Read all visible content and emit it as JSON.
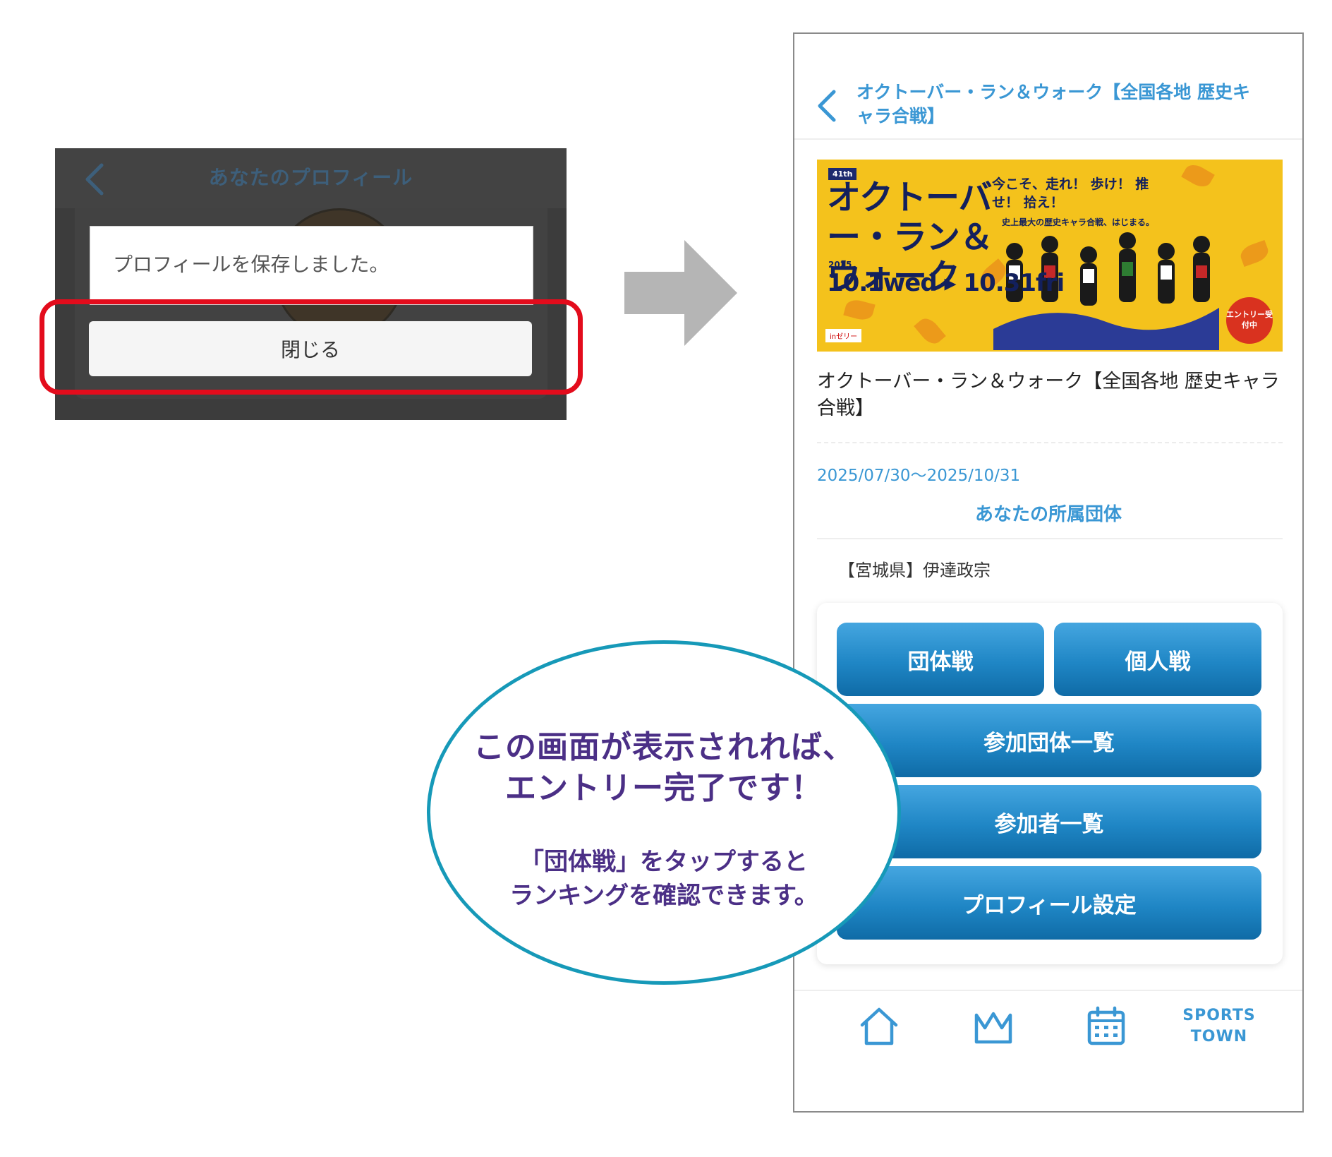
{
  "dialog_screen": {
    "title": "あなたのプロフィール",
    "message": "プロフィールを保存しました。",
    "close_label": "閉じる"
  },
  "event_screen": {
    "header_title": "オクトーバー・ラン＆ウォーク【全国各地 歴史キャラ合戦】",
    "banner": {
      "badge": "41th",
      "title": "オクトーバー・ラン＆ウォーク",
      "catchcopy": "今こそ、走れ！ 歩け！ 推せ！ 拾え！",
      "subcopy": "史上最大の歴史キャラ合戦、はじまる。",
      "year": "2025",
      "dates": "10.1wed ▸ 10.31fri",
      "entry_badge": "エントリー受付中",
      "logo": "inゼリー"
    },
    "event_title": "オクトーバー・ラン＆ウォーク【全国各地 歴史キャラ合戦】",
    "dates": "2025/07/30〜2025/10/31",
    "group_heading": "あなたの所属団体",
    "group_name": "【宮城県】伊達政宗",
    "menu": {
      "team_battle": "団体戦",
      "individual_battle": "個人戦",
      "team_list": "参加団体一覧",
      "participant_list": "参加者一覧",
      "profile_settings": "プロフィール設定"
    },
    "nav": {
      "home_icon": "home-icon",
      "ranking_icon": "crown-icon",
      "calendar_icon": "calendar-icon",
      "brand_line1": "SPORTS",
      "brand_line2": "TOWN"
    }
  },
  "callout": {
    "line1": "この画面が表示されれば、",
    "line2": "エントリー完了です！",
    "line3": "「団体戦」をタップすると",
    "line4": "ランキングを確認できます。"
  },
  "colors": {
    "accent_blue": "#3a97d4",
    "button_blue": "#1f86c5",
    "highlight_red": "#e30c1c",
    "bubble_border": "#1699b8",
    "bubble_text": "#4b2f86",
    "banner_yellow": "#f4c21c"
  }
}
